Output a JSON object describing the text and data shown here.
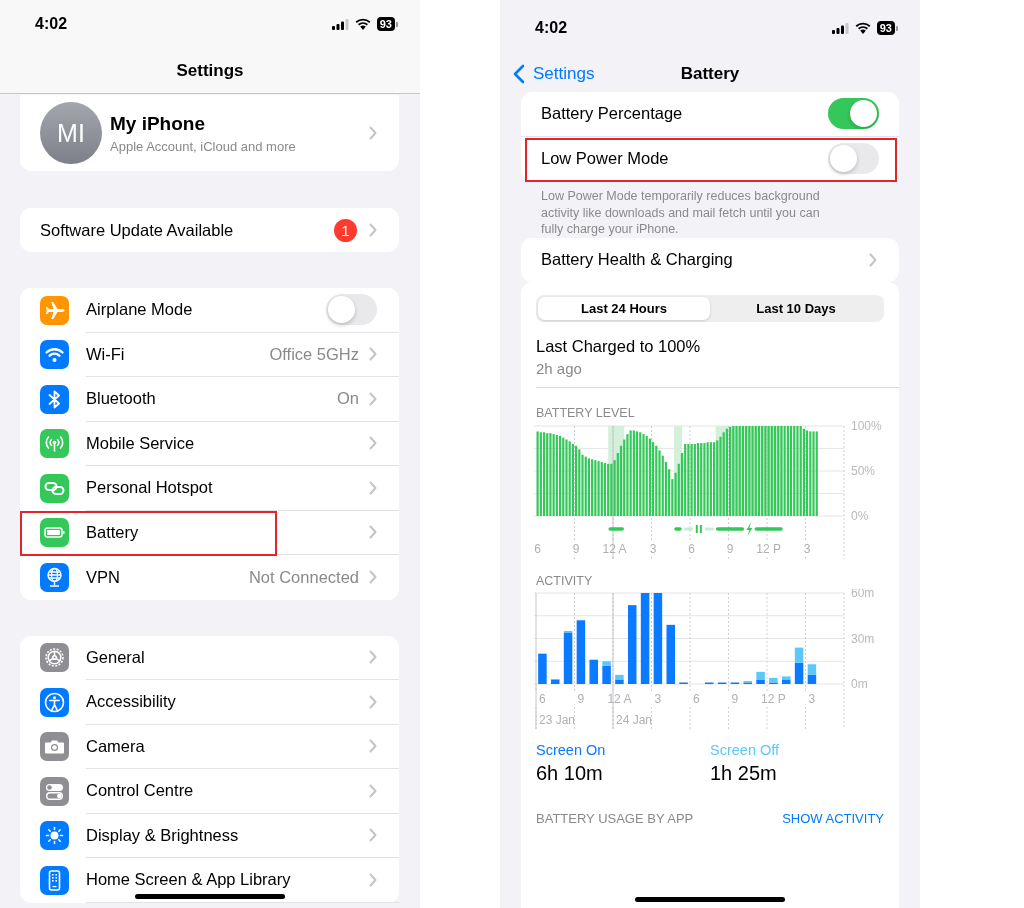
{
  "settings_screen": {
    "status_bar": {
      "time": "4:02",
      "battery": "93"
    },
    "title": "Settings",
    "profile": {
      "initials": "MI",
      "name": "My iPhone",
      "subtitle": "Apple Account, iCloud and more"
    },
    "update": {
      "label": "Software Update Available",
      "badge": "1"
    },
    "groups": [
      {
        "rows": [
          {
            "label": "Airplane Mode",
            "kind": "toggle",
            "on": false,
            "highlighted": false
          },
          {
            "label": "Wi-Fi",
            "kind": "link",
            "value": "Office 5GHz",
            "highlighted": false
          },
          {
            "label": "Bluetooth",
            "kind": "link",
            "value": "On",
            "highlighted": false
          },
          {
            "label": "Mobile Service",
            "kind": "link",
            "highlighted": false
          },
          {
            "label": "Personal Hotspot",
            "kind": "link",
            "highlighted": false
          },
          {
            "label": "Battery",
            "kind": "link",
            "highlighted": true
          },
          {
            "label": "VPN",
            "kind": "link",
            "value": "Not Connected",
            "highlighted": false
          }
        ]
      },
      {
        "rows": [
          {
            "label": "General",
            "kind": "link",
            "highlighted": false
          },
          {
            "label": "Accessibility",
            "kind": "link",
            "highlighted": false
          },
          {
            "label": "Camera",
            "kind": "link",
            "highlighted": false
          },
          {
            "label": "Control Centre",
            "kind": "link",
            "highlighted": false
          },
          {
            "label": "Display & Brightness",
            "kind": "link",
            "highlighted": false
          },
          {
            "label": "Home Screen & App Library",
            "kind": "link",
            "highlighted": false
          }
        ]
      }
    ]
  },
  "battery_screen": {
    "status_bar": {
      "time": "4:02",
      "battery": "93"
    },
    "back_label": "Settings",
    "title": "Battery",
    "toggles": [
      {
        "label": "Battery Percentage",
        "on": true,
        "highlighted": false
      },
      {
        "label": "Low Power Mode",
        "on": false,
        "highlighted": true
      }
    ],
    "footnote": "Low Power Mode temporarily reduces background activity like downloads and mail fetch until you can fully charge your iPhone.",
    "health": {
      "label": "Battery Health & Charging"
    },
    "segments": [
      {
        "label": "Last 24 Hours",
        "selected": true
      },
      {
        "label": "Last 10 Days",
        "selected": false
      }
    ],
    "last_charged": "Last Charged to 100%",
    "last_charged_ago": "2h ago",
    "battery_level": {
      "heading": "BATTERY LEVEL",
      "chart_data": {
        "type": "bar",
        "ylim": [
          0,
          100
        ],
        "categories": [
          "6",
          null,
          null,
          null,
          null,
          null,
          null,
          null,
          null,
          null,
          null,
          null,
          "9",
          null,
          null,
          null,
          null,
          null,
          null,
          null,
          null,
          null,
          null,
          null,
          "12 A",
          null,
          null,
          null,
          null,
          null,
          null,
          null,
          null,
          null,
          null,
          null,
          "3",
          null,
          null,
          null,
          null,
          null,
          null,
          null,
          null,
          null,
          null,
          null,
          "6",
          null,
          null,
          null,
          null,
          null,
          null,
          null,
          null,
          null,
          null,
          null,
          "9",
          null,
          null,
          null,
          null,
          null,
          null,
          null,
          null,
          null,
          null,
          null,
          "12 P",
          null,
          null,
          null,
          null,
          null,
          null,
          null,
          null,
          null,
          null,
          null,
          "3",
          null,
          null,
          null,
          null,
          null,
          null,
          null,
          null,
          null,
          null,
          null
        ],
        "values": [
          94,
          93,
          93,
          92,
          92,
          91,
          90,
          89,
          87,
          85,
          83,
          80,
          78,
          74,
          68,
          66,
          64,
          63,
          62,
          61,
          60,
          59,
          58,
          58,
          62,
          70,
          78,
          85,
          91,
          95,
          95,
          94,
          93,
          91,
          89,
          86,
          82,
          78,
          73,
          67,
          60,
          52,
          41,
          48,
          58,
          70,
          80,
          80,
          80,
          80,
          81,
          81,
          81,
          82,
          82,
          82,
          84,
          88,
          93,
          97,
          99,
          100,
          100,
          100,
          100,
          100,
          100,
          100,
          100,
          100,
          100,
          100,
          100,
          100,
          100,
          100,
          100,
          100,
          100,
          100,
          100,
          100,
          100,
          97,
          95,
          94,
          94,
          94,
          null,
          null,
          null,
          null,
          null,
          null,
          null,
          null
        ],
        "yticks": [
          {
            "value": 0,
            "label": "0%"
          },
          {
            "value": 50,
            "label": "50%"
          },
          {
            "value": 100,
            "label": "100%"
          }
        ]
      }
    },
    "activity": {
      "heading": "ACTIVITY",
      "chart_data": {
        "type": "bar",
        "stacked": true,
        "ylim": [
          0,
          60
        ],
        "categories": [
          "6",
          null,
          null,
          "9",
          null,
          null,
          "12 A",
          null,
          null,
          "3",
          null,
          null,
          "6",
          null,
          null,
          "9",
          null,
          null,
          "12 P",
          null,
          null,
          "3",
          null,
          null
        ],
        "series": [
          {
            "name": "Screen On",
            "color": "#0a7aff",
            "values": [
              20,
              3,
              34,
              42,
              16,
              12,
              3,
              52,
              60,
              60,
              39,
              1,
              0,
              1,
              1,
              1,
              1,
              3,
              1,
              3,
              14,
              6,
              null,
              null
            ]
          },
          {
            "name": "Screen Off",
            "color": "#5ac8fa",
            "values": [
              0,
              0,
              1,
              0,
              0,
              3,
              3,
              0,
              0,
              0,
              0,
              0,
              0,
              0,
              0,
              0,
              1,
              5,
              3,
              2,
              10,
              7,
              null,
              null
            ]
          }
        ],
        "yticks": [
          {
            "value": 0,
            "label": "0m"
          },
          {
            "value": 30,
            "label": "30m"
          },
          {
            "value": 60,
            "label": "60m"
          }
        ]
      },
      "date_labels": [
        "23 Jan",
        "24 Jan"
      ]
    },
    "totals": [
      {
        "value": "6h 10m"
      },
      {
        "value": "1h 25m"
      }
    ],
    "usage_heading": "BATTERY USAGE BY APP",
    "show_activity": "SHOW ACTIVITY"
  }
}
